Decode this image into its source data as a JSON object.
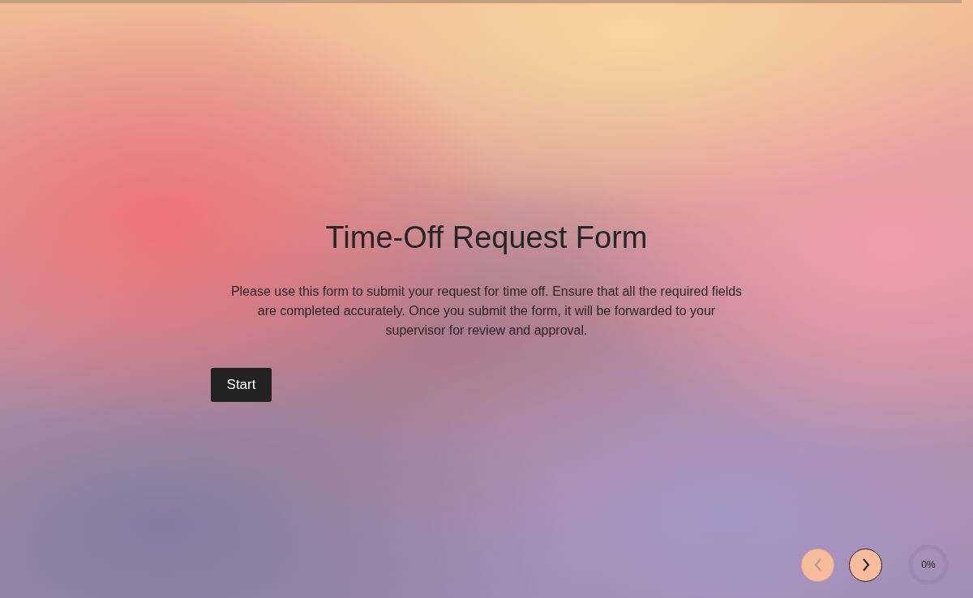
{
  "title": "Time-Off Request Form",
  "description": "Please use this form to submit your request for time off. Ensure that all the required fields are completed accurately. Once you submit the form, it will be forwarded to your supervisor for review and approval.",
  "start_button": "Start",
  "navigation": {
    "previous": {
      "disabled": true
    },
    "next": {
      "disabled": false
    }
  },
  "progress": {
    "label": "0%"
  }
}
